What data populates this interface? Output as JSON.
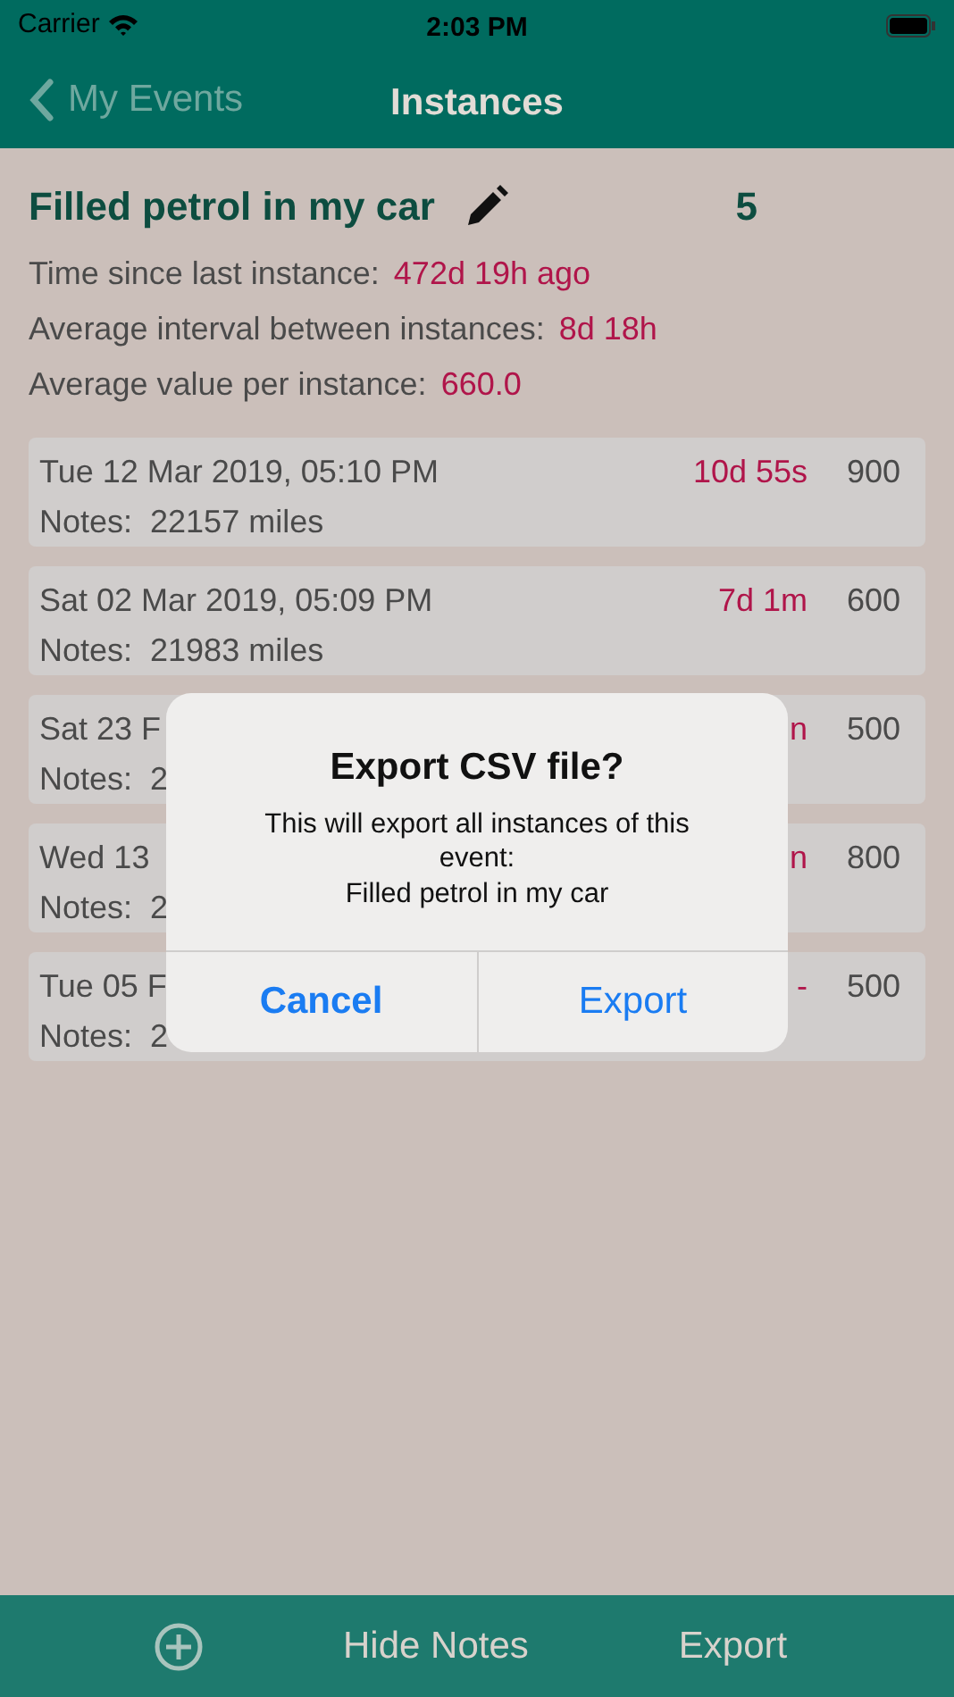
{
  "status_bar": {
    "carrier": "Carrier",
    "time": "2:03 PM"
  },
  "nav": {
    "back": "My Events",
    "title": "Instances"
  },
  "event": {
    "title": "Filled petrol in my car",
    "count": "5"
  },
  "stats": [
    {
      "label": "Time since last instance:",
      "value": "472d 19h ago"
    },
    {
      "label": "Average interval between instances:",
      "value": "8d 18h"
    },
    {
      "label": "Average value per instance:",
      "value": "660.0"
    }
  ],
  "instances": [
    {
      "date": "Tue 12 Mar 2019, 05:10 PM",
      "interval": "10d 55s",
      "value": "900",
      "notes": "Notes:  22157 miles"
    },
    {
      "date": "Sat 02 Mar 2019, 05:09 PM",
      "interval": "7d 1m",
      "value": "600",
      "notes": "Notes:  21983 miles"
    },
    {
      "date": "Sat 23 F",
      "interval": "n",
      "value": "500",
      "notes": "Notes:  2"
    },
    {
      "date": "Wed 13",
      "interval": "n",
      "value": "800",
      "notes": "Notes:  2"
    },
    {
      "date": "Tue 05 F",
      "interval": "-",
      "value": "500",
      "notes": "Notes:  2"
    }
  ],
  "dialog": {
    "title": "Export CSV file?",
    "message": "This will export all instances of this event:\nFilled petrol in my car",
    "buttons": [
      {
        "label": "Cancel",
        "kind": "cancel"
      },
      {
        "label": "Export",
        "kind": "default"
      }
    ]
  },
  "toolbar": {
    "hide_notes": "Hide Notes",
    "export": "Export"
  }
}
